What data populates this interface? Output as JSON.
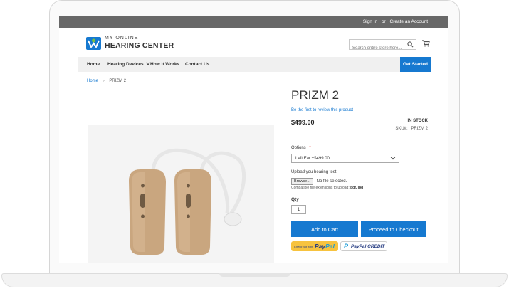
{
  "topbar": {
    "sign_in": "Sign In",
    "or": "or",
    "create_account": "Create an Account"
  },
  "logo": {
    "line1": "MY ONLINE",
    "line2": "HEARING CENTER"
  },
  "search": {
    "placeholder": "Search entire store here..."
  },
  "nav": {
    "items": [
      "Home",
      "Hearing Devices",
      "How it Works",
      "Contact Us"
    ],
    "cta": "Get Started"
  },
  "breadcrumb": {
    "home": "Home",
    "separator": "›",
    "current": "PRIZM 2"
  },
  "product": {
    "title": "PRIZM 2",
    "review_link": "Be the first to review this product",
    "price": "$499.00",
    "stock": "IN STOCK",
    "sku_label": "SKU#:",
    "sku": "PRIZM 2",
    "options_label": "Options",
    "required_mark": "*",
    "option_selected": "Left Ear +$499.00",
    "upload_label": "Upload you hearing test",
    "browse_label": "Browse...",
    "file_status": "No file selected.",
    "compat_text": "Compatible file extensions to upload:",
    "compat_ext": "pdf, jpg",
    "qty_label": "Qty",
    "qty": "1",
    "add_to_cart": "Add to Cart",
    "checkout": "Proceed to Checkout"
  },
  "paypal": {
    "checkout_prefix": "Check out with",
    "brand_a": "Pay",
    "brand_b": "Pal",
    "credit": "PayPal CREDIT"
  },
  "colors": {
    "accent": "#1679d0",
    "topbar": "#686868",
    "nav_bg": "#f0f0f0",
    "logo_green": "#78c043",
    "device_beige": "#c9a67f"
  }
}
